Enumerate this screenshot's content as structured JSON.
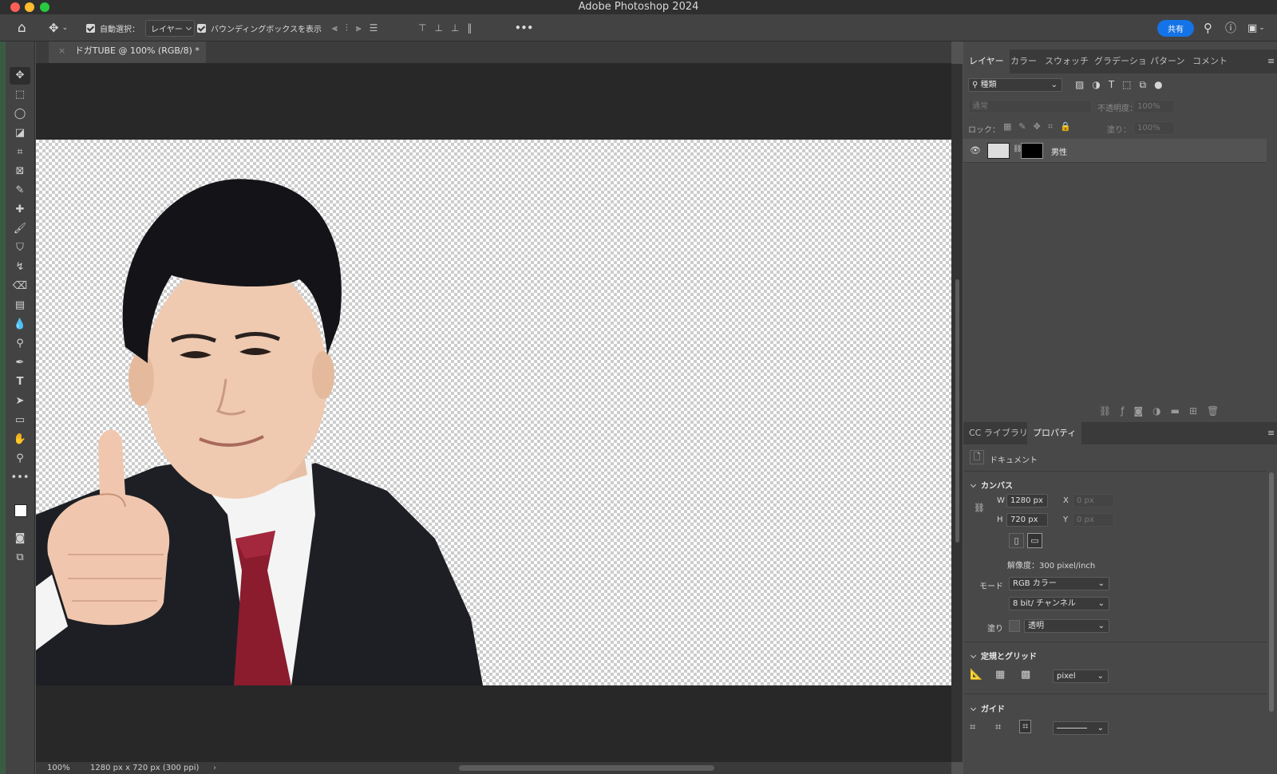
{
  "app": {
    "title": "Adobe Photoshop 2024"
  },
  "options_bar": {
    "auto_select_label": "自動選択：",
    "auto_select_value": "レイヤー",
    "bounding_box_label": "バウンディングボックスを表示",
    "more_label": "•••",
    "share_label": "共有"
  },
  "document": {
    "tab_title": "ドガTUBE @ 100% (RGB/8) *",
    "zoom": "100%",
    "info": "1280 px x 720 px (300 ppi)"
  },
  "layers_panel": {
    "tabs": [
      "レイヤー",
      "カラー",
      "スウォッチ",
      "グラデーショ",
      "パターン",
      "コメント"
    ],
    "filter_value": "種類",
    "blend_mode": "通常",
    "opacity_label": "不透明度：",
    "opacity_value": "100%",
    "lock_label": "ロック：",
    "fill_label": "塗り：",
    "fill_value": "100%",
    "layers": [
      {
        "name": "男性",
        "visible": true
      }
    ]
  },
  "properties_panel": {
    "tabs": [
      "CC ライブラリ",
      "プロパティ"
    ],
    "doc_label": "ドキュメント",
    "canvas_section": "カンバス",
    "w_label": "W",
    "w_value": "1280 px",
    "h_label": "H",
    "h_value": "720 px",
    "x_label": "X",
    "x_placeholder": "0 px",
    "y_label": "Y",
    "y_placeholder": "0 px",
    "resolution": "解像度：300 pixel/inch",
    "mode_label": "モード",
    "mode_value": "RGB カラー",
    "bit_value": "8 bit/ チャンネル",
    "fill_label": "塗り",
    "fill_value": "透明",
    "rulers_section": "定規とグリッド",
    "ruler_unit": "pixel",
    "guides_section": "ガイド"
  },
  "colors": {
    "accent": "#1473e6",
    "panel": "#484848",
    "workspace": "#282828"
  }
}
